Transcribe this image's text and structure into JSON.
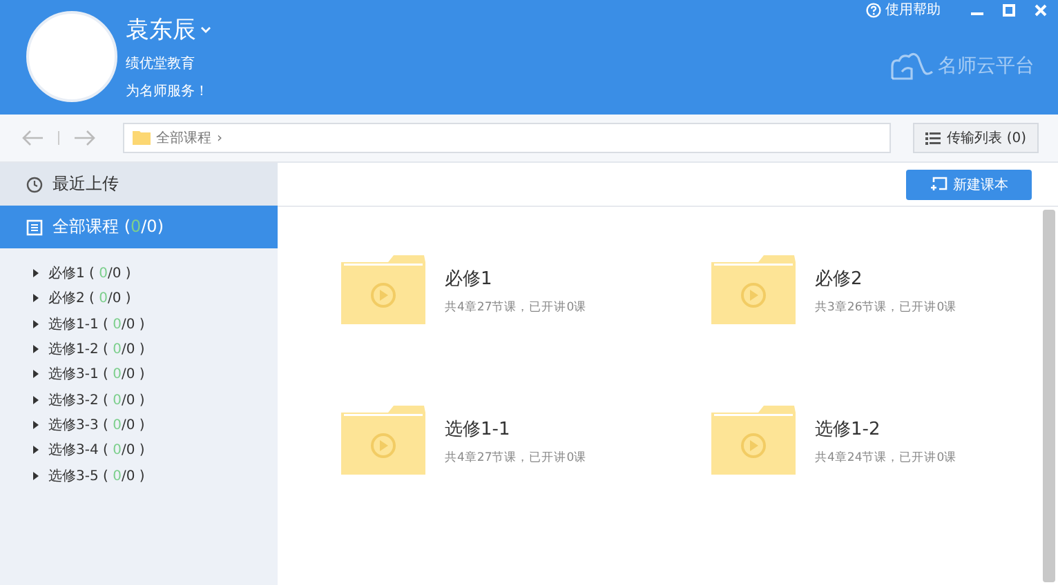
{
  "header": {
    "user_name": "袁东辰",
    "org": "绩优堂教育",
    "slogan": "为名师服务！",
    "help": "使用帮助",
    "brand": "名师云平台"
  },
  "toolbar": {
    "path": "全部课程",
    "path_sep": "›",
    "transfer": "传输列表 (0)"
  },
  "sidebar": {
    "recent": {
      "label": "最近上传",
      "selected": false
    },
    "all": {
      "label": "全部课程 (",
      "done": "0",
      "suffix": "/0)",
      "selected": true
    },
    "tree": [
      {
        "prefix": "必修1 ( ",
        "done": "0",
        "suffix": "/0 )",
        "expanded": false
      },
      {
        "prefix": "必修2 ( ",
        "done": "0",
        "suffix": "/0 )",
        "expanded": false
      },
      {
        "prefix": "选修1-1 ( ",
        "done": "0",
        "suffix": "/0 )",
        "expanded": false
      },
      {
        "prefix": "选修1-2 ( ",
        "done": "0",
        "suffix": "/0 )",
        "expanded": false
      },
      {
        "prefix": "选修3-1 ( ",
        "done": "0",
        "suffix": "/0 )",
        "expanded": false
      },
      {
        "prefix": "选修3-2 ( ",
        "done": "0",
        "suffix": "/0 )",
        "expanded": false
      },
      {
        "prefix": "选修3-3 ( ",
        "done": "0",
        "suffix": "/0 )",
        "expanded": false
      },
      {
        "prefix": "选修3-4 ( ",
        "done": "0",
        "suffix": "/0 )",
        "expanded": false
      },
      {
        "prefix": "选修3-5 ( ",
        "done": "0",
        "suffix": "/0 )",
        "expanded": false
      }
    ]
  },
  "main": {
    "new_button": "新建课本",
    "courses": [
      {
        "title": "必修1",
        "meta": "共4章27节课，已开讲0课"
      },
      {
        "title": "必修2",
        "meta": "共3章26节课，已开讲0课"
      },
      {
        "title": "选修1-1",
        "meta": "共4章27节课，已开讲0课"
      },
      {
        "title": "选修1-2",
        "meta": "共4章24节课，已开讲0课"
      }
    ]
  }
}
